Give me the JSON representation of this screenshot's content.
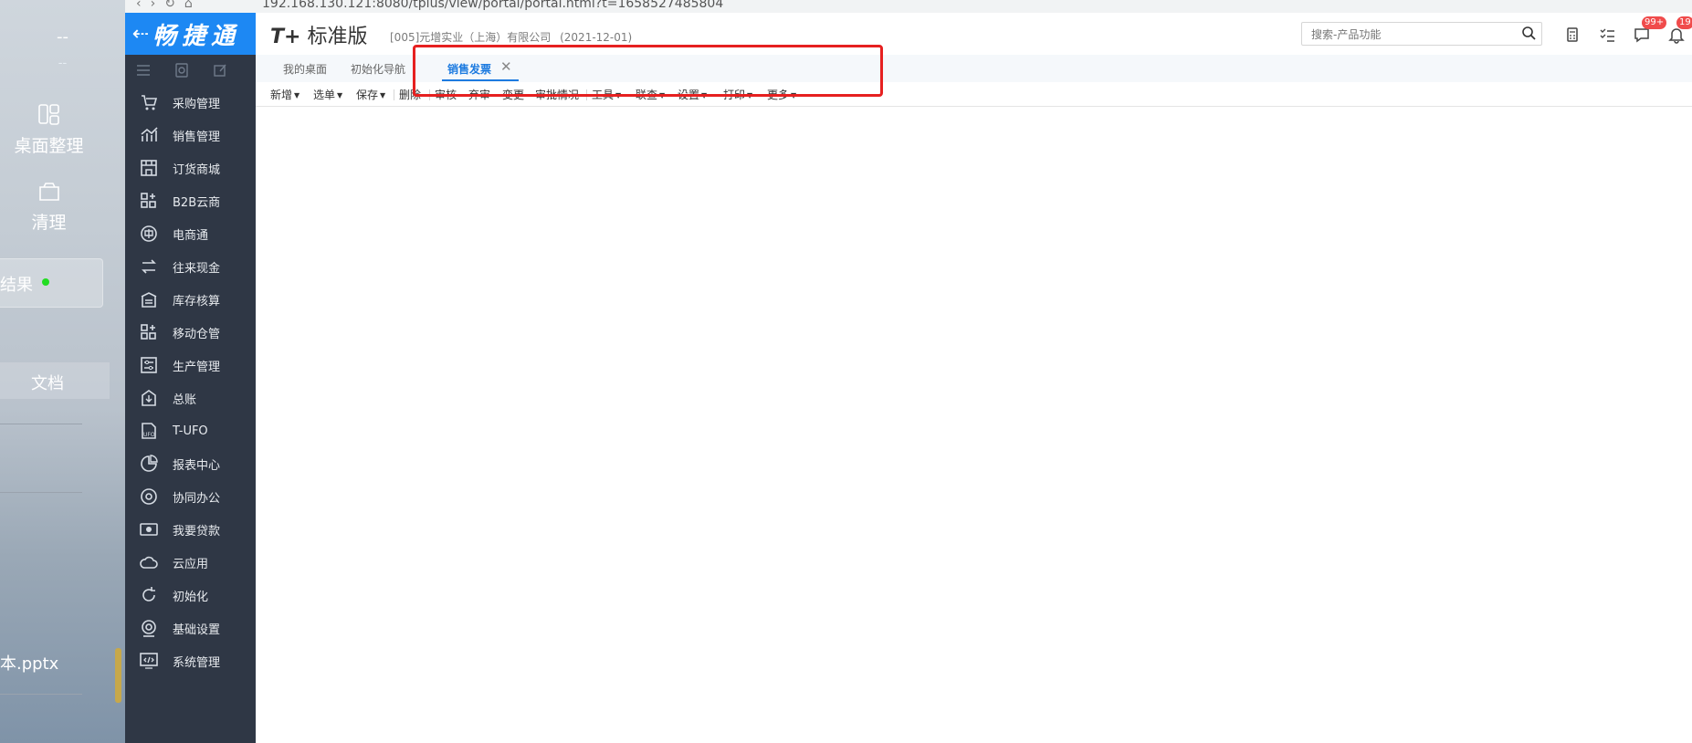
{
  "desktop": {
    "top_value": "--",
    "top_sub": "--",
    "organize_label": "桌面整理",
    "clean_label": "清理",
    "result_label": "结果",
    "doc_label": "文档",
    "file_label": "本.pptx"
  },
  "browser": {
    "url": "192.168.130.121:8080/tplus/view/portal/portal.html?t=1658527485804"
  },
  "brand": {
    "name": "畅捷通",
    "back_icon": "arrow-left-icon"
  },
  "header": {
    "product": "标准版",
    "product_mark": "T+",
    "company": "[005]元增实业（上海）有限公司",
    "date": "(2021-12-01)",
    "search_placeholder": "搜索-产品功能",
    "badge_messages": "99+",
    "badge_notifications": "19"
  },
  "sidebar": {
    "items": [
      {
        "label": "采购管理",
        "icon": "cart-icon"
      },
      {
        "label": "销售管理",
        "icon": "chart-up-icon"
      },
      {
        "label": "订货商城",
        "icon": "store-icon"
      },
      {
        "label": "B2B云商",
        "icon": "grid-plus-icon"
      },
      {
        "label": "电商通",
        "icon": "circle-dian-icon"
      },
      {
        "label": "往来现金",
        "icon": "exchange-icon"
      },
      {
        "label": "库存核算",
        "icon": "warehouse-icon"
      },
      {
        "label": "移动仓管",
        "icon": "grid-plus-icon"
      },
      {
        "label": "生产管理",
        "icon": "sliders-icon"
      },
      {
        "label": "总账",
        "icon": "ledger-icon"
      },
      {
        "label": "T-UFO",
        "icon": "ufo-doc-icon"
      },
      {
        "label": "报表中心",
        "icon": "pie-icon"
      },
      {
        "label": "协同办公",
        "icon": "target-icon"
      },
      {
        "label": "我要贷款",
        "icon": "money-icon"
      },
      {
        "label": "云应用",
        "icon": "cloud-icon"
      },
      {
        "label": "初始化",
        "icon": "refresh-icon"
      },
      {
        "label": "基础设置",
        "icon": "gear-icon"
      },
      {
        "label": "系统管理",
        "icon": "monitor-code-icon"
      }
    ]
  },
  "tabs": [
    {
      "label": "我的桌面"
    },
    {
      "label": "初始化导航"
    },
    {
      "label": "销售发票",
      "active": true
    }
  ],
  "toolbar": [
    {
      "label": "新增",
      "dropdown": true
    },
    {
      "label": "选单",
      "dropdown": true
    },
    {
      "label": "保存",
      "dropdown": true
    },
    {
      "label": "删除",
      "dropdown": false
    },
    {
      "label": "审核",
      "dropdown": false
    },
    {
      "label": "弃审",
      "dropdown": false
    },
    {
      "label": "变更",
      "dropdown": false
    },
    {
      "label": "审批情况",
      "dropdown": false
    },
    {
      "label": "工具",
      "dropdown": true
    },
    {
      "label": "联查",
      "dropdown": true
    },
    {
      "label": "设置",
      "dropdown": true
    },
    {
      "label": "打印",
      "dropdown": true
    },
    {
      "label": "更多",
      "dropdown": true
    }
  ],
  "colors": {
    "brand_blue": "#1d88f3",
    "sidebar_bg": "#2f3745",
    "active_tab": "#1d7be0",
    "highlight_red": "#e62020",
    "badge_red": "#f04b4b"
  }
}
